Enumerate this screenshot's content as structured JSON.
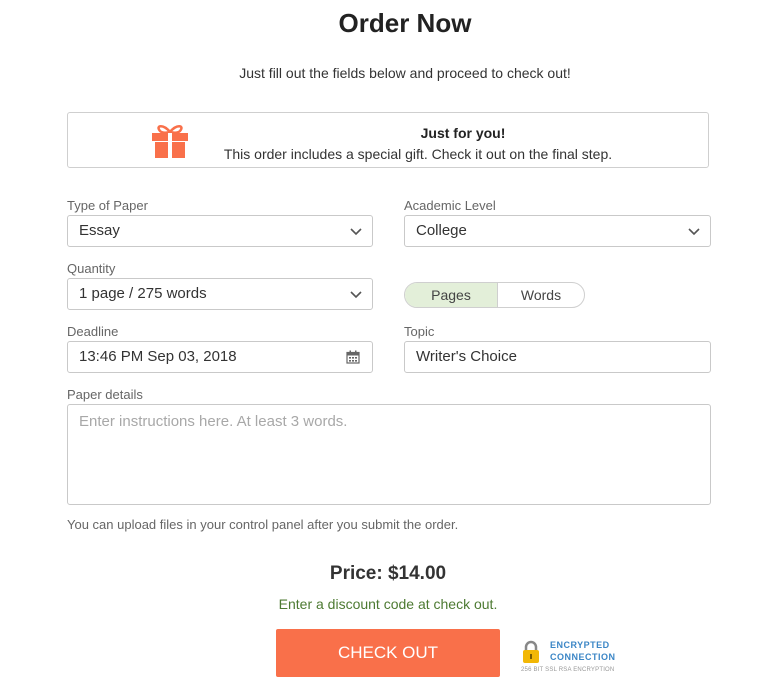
{
  "header": {
    "title": "Order Now",
    "subtitle": "Just fill out the fields below and proceed to check out!"
  },
  "gift": {
    "icon": "gift-icon",
    "title": "Just for you!",
    "text": "This order includes a special gift. Check it out on the final step."
  },
  "form": {
    "paper_type": {
      "label": "Type of Paper",
      "value": "Essay"
    },
    "academic_level": {
      "label": "Academic Level",
      "value": "College"
    },
    "quantity": {
      "label": "Quantity",
      "value": "1 page / 275 words"
    },
    "unit_toggle": {
      "options": [
        "Pages",
        "Words"
      ],
      "selected": "Pages"
    },
    "deadline": {
      "label": "Deadline",
      "value": "13:46 PM Sep 03, 2018"
    },
    "topic": {
      "label": "Topic",
      "value": "Writer's Choice"
    },
    "details": {
      "label": "Paper details",
      "placeholder": "Enter instructions here. At least 3 words."
    },
    "upload_note": "You can upload files in your control panel after you submit the order."
  },
  "price": {
    "text": "Price: $14.00"
  },
  "discount": {
    "text": "Enter a discount code at check out."
  },
  "checkout": {
    "label": "CHECK OUT"
  },
  "security": {
    "line1": "ENCRYPTED",
    "line2": "CONNECTION",
    "line3": "256 BIT SSL RSA ENCRYPTION"
  },
  "colors": {
    "accent": "#f9704a",
    "toggle_active": "#e3efd9",
    "discount_text": "#4d7a32",
    "secure_blue": "#3b86c6"
  }
}
